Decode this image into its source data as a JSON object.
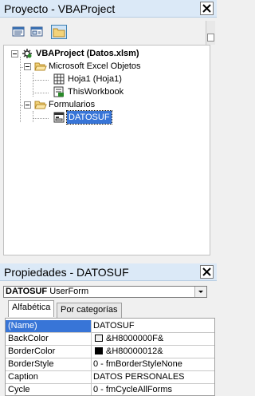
{
  "project_panel": {
    "title": "Proyecto - VBAProject",
    "tree": {
      "root_label": "VBAProject (Datos.xlsm)",
      "folder1_label": "Microsoft Excel Objetos",
      "sheet1_label": "Hoja1 (Hoja1)",
      "workbook_label": "ThisWorkbook",
      "folder2_label": "Formularios",
      "form_label": "DATOSUF"
    }
  },
  "properties_panel": {
    "title": "Propiedades - DATOSUF",
    "object_name": "DATOSUF",
    "object_type": "UserForm",
    "tabs": [
      "Alfabética",
      "Por categorías"
    ],
    "rows": [
      {
        "name": "(Name)",
        "value": "DATOSUF"
      },
      {
        "name": "BackColor",
        "value": "&H8000000F&"
      },
      {
        "name": "BorderColor",
        "value": "&H80000012&"
      },
      {
        "name": "BorderStyle",
        "value": "0 - fmBorderStyleNone"
      },
      {
        "name": "Caption",
        "value": "DATOS PERSONALES"
      },
      {
        "name": "Cycle",
        "value": "0 - fmCycleAllForms"
      }
    ]
  },
  "colors": {
    "title_bg": "#dbe9f7",
    "selection": "#3875d7",
    "backcolor_swatch": "#f0f0f0",
    "bordercolor_swatch": "#000000"
  }
}
